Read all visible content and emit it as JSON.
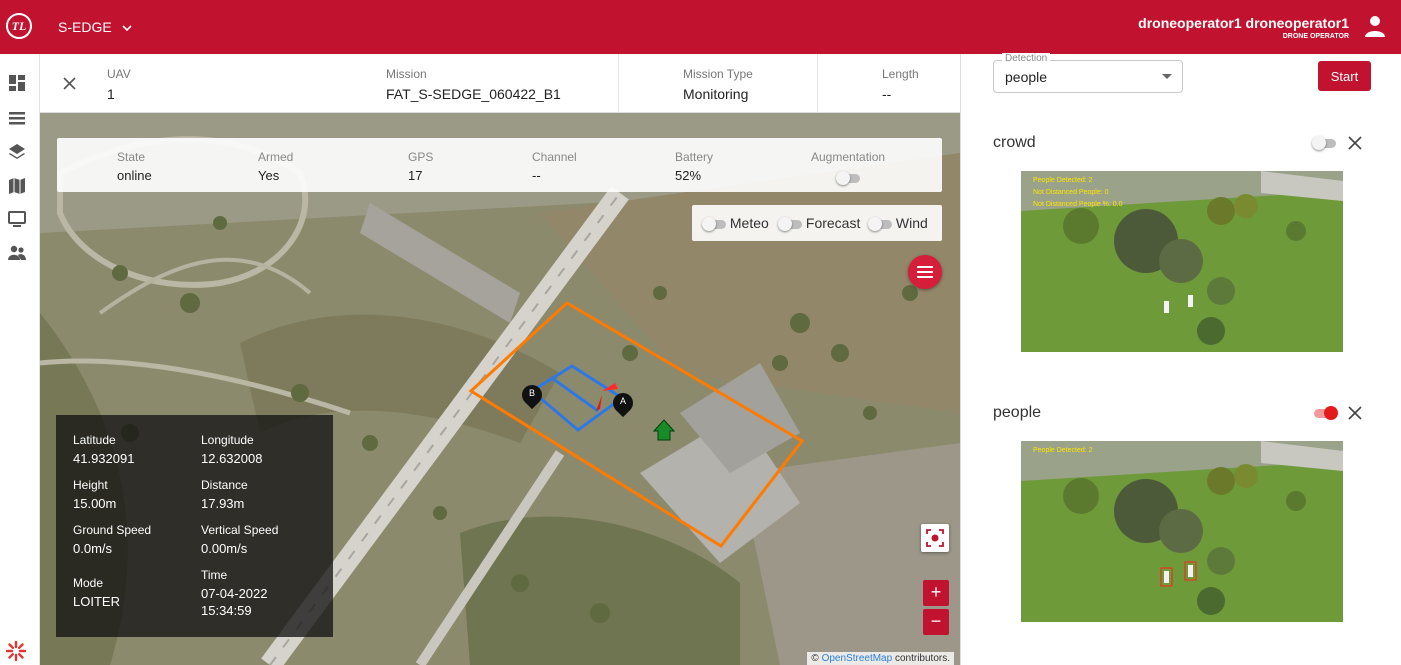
{
  "app": {
    "logo": "TL",
    "name": "S-EDGE",
    "user_name": "droneoperator1 droneoperator1",
    "user_role": "DRONE OPERATOR",
    "brand_color": "#c1122f"
  },
  "sidebar": {
    "icons": [
      "dashboard-icon",
      "list-icon",
      "layers-icon",
      "map-icon",
      "monitor-icon",
      "people-icon"
    ]
  },
  "mission": {
    "uav_label": "UAV",
    "uav_value": "1",
    "mission_label": "Mission",
    "mission_value": "FAT_S-SEDGE_060422_B1",
    "type_label": "Mission Type",
    "type_value": "Monitoring",
    "length_label": "Length",
    "length_value": "--"
  },
  "status": {
    "state_label": "State",
    "state_value": "online",
    "armed_label": "Armed",
    "armed_value": "Yes",
    "gps_label": "GPS",
    "gps_value": "17",
    "channel_label": "Channel",
    "channel_value": "--",
    "battery_label": "Battery",
    "battery_value": "52%",
    "augmentation_label": "Augmentation",
    "augmentation_on": false
  },
  "layers": {
    "meteo": "Meteo",
    "forecast": "Forecast",
    "wind": "Wind"
  },
  "telemetry": {
    "latitude_label": "Latitude",
    "latitude": "41.932091",
    "longitude_label": "Longitude",
    "longitude": "12.632008",
    "height_label": "Height",
    "height": "15.00m",
    "distance_label": "Distance",
    "distance": "17.93m",
    "ground_speed_label": "Ground Speed",
    "ground_speed": "0.0m/s",
    "vertical_speed_label": "Vertical Speed",
    "vertical_speed": "0.00m/s",
    "mode_label": "Mode",
    "mode": "LOITER",
    "time_label": "Time",
    "date": "07-04-2022",
    "time": "15:34:59"
  },
  "map": {
    "waypoint_a": "A",
    "waypoint_b": "B",
    "zoom_in": "+",
    "zoom_out": "−",
    "attribution_prefix": "© ",
    "attribution_link": "OpenStreetMap",
    "attribution_suffix": " contributors."
  },
  "detection": {
    "select_label": "Detection",
    "select_value": "people",
    "start_label": "Start",
    "crowd_title": "crowd",
    "crowd_enabled": false,
    "crowd_overlay": [
      "People Detected: 2",
      "Not Distanced People: 0",
      "Not Distanced People %: 0.0"
    ],
    "people_title": "people",
    "people_enabled": true,
    "people_overlay": [
      "People Detected: 2"
    ]
  }
}
